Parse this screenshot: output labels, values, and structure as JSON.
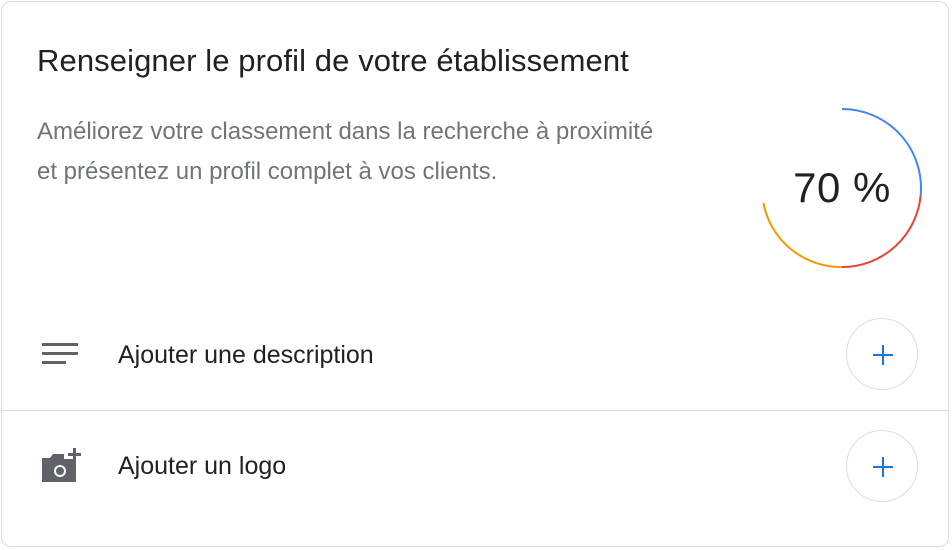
{
  "card": {
    "title": "Renseigner le profil de votre établissement",
    "subtitle": "Améliorez votre classement dans la recherche à proximité et présentez un profil complet à vos clients."
  },
  "progress": {
    "label": "70 %",
    "value": 0.7,
    "segment_colors": [
      "#4285f4",
      "#ea4335",
      "#fbbc04"
    ]
  },
  "tasks": [
    {
      "label": "Ajouter une description",
      "icon": "notes-icon"
    },
    {
      "label": "Ajouter un logo",
      "icon": "add-photo-icon"
    }
  ],
  "colors": {
    "accent": "#1a73e8",
    "text_primary": "#202124",
    "text_secondary": "#70757a",
    "divider": "#dadce0"
  }
}
